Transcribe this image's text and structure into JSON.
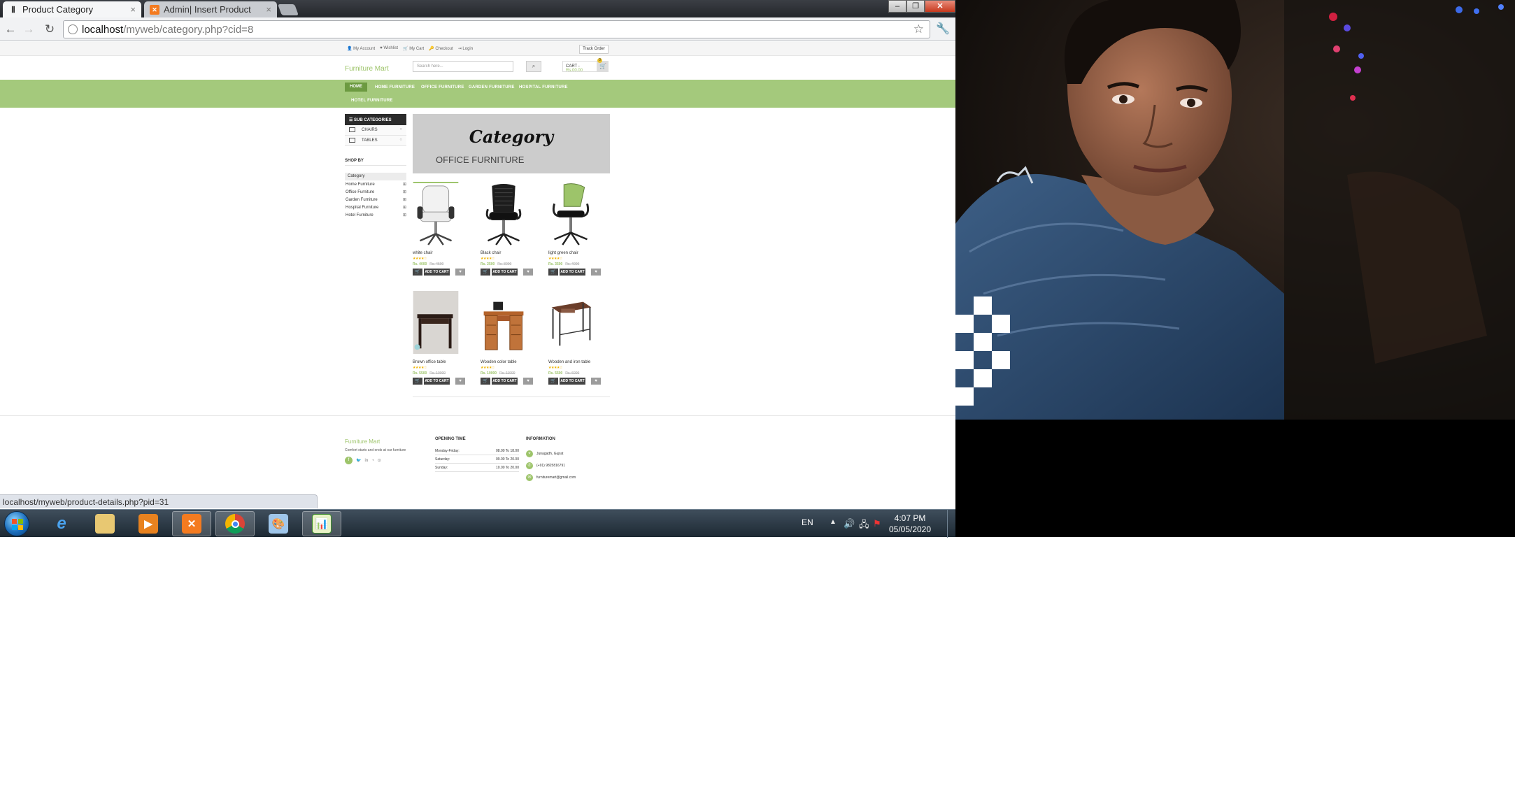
{
  "browser": {
    "tabs": [
      {
        "label": "Product Category",
        "active": true,
        "favicon": "page-icon"
      },
      {
        "label": "Admin| Insert Product",
        "active": false,
        "favicon": "xampp-icon"
      }
    ],
    "url_host": "localhost",
    "url_path": "/myweb/category.php?cid=8",
    "status_url": "localhost/myweb/product-details.php?pid=31"
  },
  "site": {
    "top_links": [
      "My Account",
      "Wishlist",
      "My Cart",
      "Checkout",
      "Login"
    ],
    "track_order": "Track Order",
    "brand": "Furniture Mart",
    "search_placeholder": "Search here...",
    "cart_label": "CART - ",
    "cart_amount": "Rs.00.00",
    "cart_count": "0",
    "nav": [
      "HOME",
      "HOME FURNITURE",
      "OFFICE FURNITURE",
      "GARDEN FURNITURE",
      "HOSPITAL FURNITURE",
      "HOTEL FURNITURE"
    ],
    "accent_color": "#a4c97c",
    "sidebar": {
      "sub_categories_title": "SUB CATEGORIES",
      "sub_categories": [
        "CHAIRS",
        "TABLES"
      ],
      "shop_by_title": "SHOP BY",
      "category_title": "Category",
      "categories": [
        "Home Furniture",
        "Office Furniture",
        "Garden Furniture",
        "Hospital Furniture",
        "Hotel Furniture"
      ]
    },
    "banner": {
      "title": "Category",
      "subtitle": "OFFICE FURNITURE"
    },
    "products": [
      {
        "name": "white chair",
        "rating": "★★★★☆",
        "price": "Rs. 4000",
        "old_price": "Rs. 4500",
        "add_label": "ADD TO CART"
      },
      {
        "name": "Black chair",
        "rating": "★★★★☆",
        "price": "Rs. 2500",
        "old_price": "Rs. 3000",
        "add_label": "ADD TO CART"
      },
      {
        "name": "light green chair",
        "rating": "★★★★☆",
        "price": "Rs. 3500",
        "old_price": "Rs. 4000",
        "add_label": "ADD TO CART"
      },
      {
        "name": "Brown office table",
        "rating": "★★★★☆",
        "price": "Rs. 5500",
        "old_price": "Rs. 10000",
        "add_label": "ADD TO CART"
      },
      {
        "name": "Wooden color table",
        "rating": "★★★★☆",
        "price": "Rs. 10000",
        "old_price": "Rs. 11000",
        "add_label": "ADD TO CART"
      },
      {
        "name": "Wooden and iron table",
        "rating": "★★★★☆",
        "price": "Rs. 5500",
        "old_price": "Rs. 6000",
        "add_label": "ADD TO CART"
      }
    ],
    "footer": {
      "brand": "Furniture Mart",
      "tagline": "Comfort starts and ends at our furniture",
      "opening_title": "OPENING TIME",
      "hours": [
        {
          "day": "Monday-Friday:",
          "time": "08.00 To 18.00"
        },
        {
          "day": "Saturday:",
          "time": "09.00 To 20.00"
        },
        {
          "day": "Sunday:",
          "time": "10.00 To 20.00"
        }
      ],
      "info_title": "INFORMATION",
      "info": [
        "Junagadh, Gujrat",
        "(+91) 9825816791",
        "furnituremart@gmail.com"
      ]
    }
  },
  "taskbar": {
    "language": "EN",
    "time": "4:07 PM",
    "date": "05/05/2020"
  }
}
